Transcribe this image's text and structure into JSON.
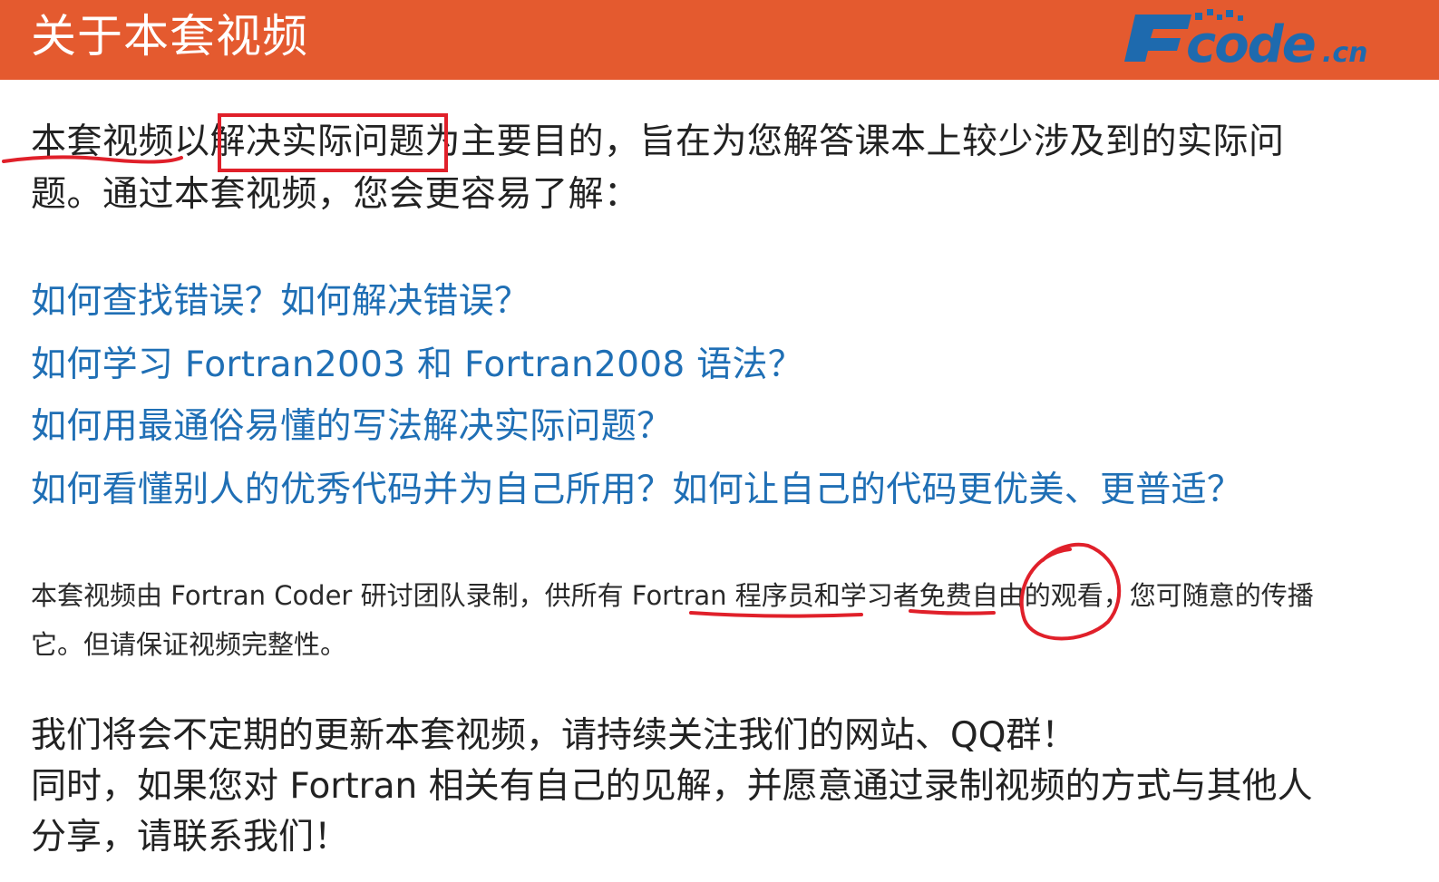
{
  "header": {
    "title": "关于本套视频",
    "logo_text": "Fcode.cn",
    "background_color": "#E45A2F",
    "logo_color": "#1E6AAE"
  },
  "intro": {
    "text": "本套视频以解决实际问题为主要目的，旨在为您解答课本上较少涉及到的实际问题。通过本套视频，您会更容易了解："
  },
  "questions": [
    "如何查找错误？如何解决错误？",
    "如何学习 Fortran2003 和 Fortran2008 语法？",
    "如何用最通俗易懂的写法解决实际问题？",
    "如何看懂别人的优秀代码并为自己所用？如何让自己的代码更优美、更普适？"
  ],
  "notice": {
    "text": "本套视频由 Fortran Coder 研讨团队录制，供所有 Fortran 程序员和学习者免费自由的观看，您可随意的传播它。但请保证视频完整性。"
  },
  "closing": {
    "line1": "我们将会不定期的更新本套视频，请持续关注我们的网站、QQ群！",
    "line2": "同时，如果您对 Fortran 相关有自己的见解，并愿意通过录制视频的方式与其他人分享，请联系我们！"
  },
  "colors": {
    "question_text": "#1F6FB5",
    "body_text": "#222222",
    "annotation": "#E0202A"
  }
}
